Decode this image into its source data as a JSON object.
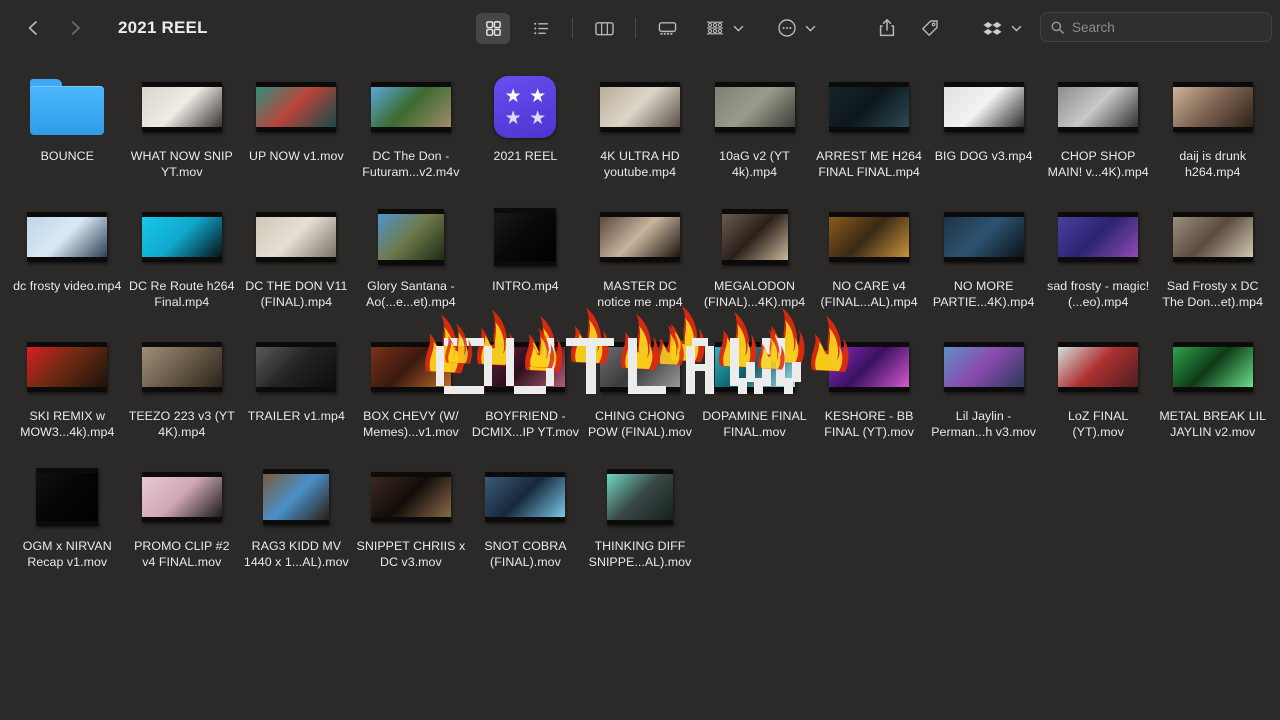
{
  "window": {
    "title": "2021 REEL",
    "background_color": "#2b2a28"
  },
  "toolbar": {
    "back_label": "Back",
    "forward_label": "Forward",
    "view_modes": [
      {
        "name": "icon-view",
        "label": "Icon View",
        "selected": true
      },
      {
        "name": "list-view",
        "label": "List View",
        "selected": false
      },
      {
        "name": "column-view",
        "label": "Column View",
        "selected": false
      },
      {
        "name": "gallery-view",
        "label": "Gallery View",
        "selected": false
      }
    ],
    "group_by_label": "Group",
    "more_label": "More",
    "share_label": "Share",
    "tag_label": "Tags",
    "dropbox_label": "Dropbox"
  },
  "search": {
    "placeholder": "Search",
    "value": ""
  },
  "watermark": {
    "text": "OUTLAW",
    "colors": {
      "fill": "#ececec",
      "flame_red": "#e02b0e",
      "flame_yellow": "#ffd21a"
    }
  },
  "files": [
    {
      "name": "BOUNCE",
      "kind": "folder",
      "accent": "#3fa9f5"
    },
    {
      "name": "WHAT NOW SNIP YT.mov",
      "kind": "video",
      "shape": "wide",
      "c1": "#d9d4cc",
      "c2": "#efece6",
      "c3": "#3a3330"
    },
    {
      "name": "UP NOW v1.mov",
      "kind": "video",
      "shape": "wide",
      "c1": "#2f8f7e",
      "c2": "#b9443a",
      "c3": "#164a49"
    },
    {
      "name": "DC The Don - Futuram...v2.m4v",
      "kind": "video",
      "shape": "wide",
      "c1": "#5aa7d8",
      "c2": "#3c6b2e",
      "c3": "#a08a6d"
    },
    {
      "name": "2021 REEL",
      "kind": "app",
      "accent": "#5b43e8"
    },
    {
      "name": "4K ULTRA HD youtube.mp4",
      "kind": "video",
      "shape": "wide",
      "c1": "#b8ad9c",
      "c2": "#ddd6c8",
      "c3": "#5a5047"
    },
    {
      "name": "10aG v2 (YT 4k).mp4",
      "kind": "video",
      "shape": "wide",
      "c1": "#7e7f72",
      "c2": "#9b9c8c",
      "c3": "#3c3d36"
    },
    {
      "name": "ARREST ME H264 FINAL FINAL.mp4",
      "kind": "video",
      "shape": "wide",
      "c1": "#16262c",
      "c2": "#0c171b",
      "c3": "#2c4a52"
    },
    {
      "name": "BIG DOG v3.mp4",
      "kind": "video",
      "shape": "wide",
      "c1": "#e2e2e2",
      "c2": "#f2f2f2",
      "c3": "#2b2b2b"
    },
    {
      "name": "CHOP SHOP MAIN! v...4K).mp4",
      "kind": "video",
      "shape": "wide",
      "c1": "#8d8d8d",
      "c2": "#c8c8c8",
      "c3": "#323232"
    },
    {
      "name": "daij is drunk h264.mp4",
      "kind": "video",
      "shape": "wide",
      "c1": "#cbb39b",
      "c2": "#7d6451",
      "c3": "#2e2119"
    },
    {
      "name": "dc frosty video.mp4",
      "kind": "video",
      "shape": "wide",
      "c1": "#bcd6ea",
      "c2": "#dbe9f4",
      "c3": "#2c3f58"
    },
    {
      "name": "DC Re Route h264 Final.mp4",
      "kind": "video",
      "shape": "wide",
      "c1": "#18c8e8",
      "c2": "#0fa8cc",
      "c3": "#071215"
    },
    {
      "name": "DC THE DON V11 (FINAL).mp4",
      "kind": "video",
      "shape": "wide",
      "c1": "#cfc7b8",
      "c2": "#e6e0d4",
      "c3": "#7a7164"
    },
    {
      "name": "Glory Santana - Ao(...e...et).mp4",
      "kind": "video",
      "shape": "tallish",
      "c1": "#4f95cf",
      "c2": "#6e7a4a",
      "c3": "#1d2a16"
    },
    {
      "name": "INTRO.mp4",
      "kind": "video",
      "shape": "square",
      "c1": "#1a1a1a",
      "c2": "#080808",
      "c3": "#000000"
    },
    {
      "name": "MASTER DC notice me .mp4",
      "kind": "video",
      "shape": "wide",
      "c1": "#5b4a40",
      "c2": "#c9b49d",
      "c3": "#1b1410"
    },
    {
      "name": "MEGALODON (FINAL)...4K).mp4",
      "kind": "video",
      "shape": "tallish",
      "c1": "#6d5a49",
      "c2": "#2a211b",
      "c3": "#cbb69b"
    },
    {
      "name": "NO CARE v4 (FINAL...AL).mp4",
      "kind": "video",
      "shape": "wide",
      "c1": "#8a5a1c",
      "c2": "#3a2a15",
      "c3": "#c8923c"
    },
    {
      "name": "NO MORE PARTIE...4K).mp4",
      "kind": "video",
      "shape": "wide",
      "c1": "#1d3448",
      "c2": "#2e5370",
      "c3": "#0a131b"
    },
    {
      "name": "sad frosty - magic! (...eo).mp4",
      "kind": "video",
      "shape": "wide",
      "c1": "#4a3fa0",
      "c2": "#2c2470",
      "c3": "#8f4bb5"
    },
    {
      "name": "Sad Frosty x DC The Don...et).mp4",
      "kind": "video",
      "shape": "wide",
      "c1": "#9c8e7f",
      "c2": "#5a4b3c",
      "c3": "#d2c7b6"
    },
    {
      "name": "SKI REMIX w MOW3...4k).mp4",
      "kind": "video",
      "shape": "wide",
      "c1": "#d81f1f",
      "c2": "#6a2b14",
      "c3": "#1d1108"
    },
    {
      "name": "TEEZO 223 v3 (YT 4K).mp4",
      "kind": "video",
      "shape": "wide",
      "c1": "#9f8f7a",
      "c2": "#6a5c49",
      "c3": "#2b241b"
    },
    {
      "name": "TRAILER v1.mp4",
      "kind": "video",
      "shape": "wide",
      "c1": "#5a5a5a",
      "c2": "#232323",
      "c3": "#0d0d0d"
    },
    {
      "name": "BOX CHEVY (W/ Memes)...v1.mov",
      "kind": "video",
      "shape": "wide",
      "c1": "#7a3018",
      "c2": "#3a1a10",
      "c3": "#c06a2a"
    },
    {
      "name": "BOYFRIEND - DCMIX...IP YT.mov",
      "kind": "video",
      "shape": "wide",
      "c1": "#6a2040",
      "c2": "#2a0f1c",
      "c3": "#b45a78"
    },
    {
      "name": "CHING CHONG POW (FINAL).mov",
      "kind": "video",
      "shape": "wide",
      "c1": "#6f6f6f",
      "c2": "#3a3a3a",
      "c3": "#9a9a9a"
    },
    {
      "name": "DOPAMINE FINAL FINAL.mov",
      "kind": "video",
      "shape": "wide",
      "c1": "#2ab5c4",
      "c2": "#0f5a66",
      "c3": "#9fe4ec"
    },
    {
      "name": "KESHORE - BB FINAL (YT).mov",
      "kind": "video",
      "shape": "wide",
      "c1": "#8a2ec0",
      "c2": "#3a1060",
      "c3": "#d45ad0"
    },
    {
      "name": "Lil Jaylin - Perman...h v3.mov",
      "kind": "video",
      "shape": "wide",
      "c1": "#5f8fc4",
      "c2": "#8a4ab0",
      "c3": "#2a3a58"
    },
    {
      "name": "LoZ FINAL (YT).mov",
      "kind": "video",
      "shape": "wide",
      "c1": "#cfe0dc",
      "c2": "#b03030",
      "c3": "#4a2020"
    },
    {
      "name": "METAL BREAK LIL JAYLIN v2.mov",
      "kind": "video",
      "shape": "wide",
      "c1": "#2fa34a",
      "c2": "#0f3a18",
      "c3": "#6ae08a"
    },
    {
      "name": "OGM x NIRVAN Recap v1.mov",
      "kind": "video",
      "shape": "square",
      "c1": "#121212",
      "c2": "#050505",
      "c3": "#000000"
    },
    {
      "name": "PROMO CLIP #2 v4 FINAL.mov",
      "kind": "video",
      "shape": "wide",
      "c1": "#e8c8d0",
      "c2": "#cfa8b4",
      "c3": "#1a1a1a"
    },
    {
      "name": "RAG3 KIDD MV 1440 x 1...AL).mov",
      "kind": "video",
      "shape": "tallish",
      "c1": "#7a5a3a",
      "c2": "#4a90c8",
      "c3": "#2a1e12"
    },
    {
      "name": "SNIPPET CHRIIS x DC v3.mov",
      "kind": "video",
      "shape": "wide",
      "c1": "#3a2a20",
      "c2": "#120c08",
      "c3": "#8a6a4a"
    },
    {
      "name": "SNOT COBRA (FINAL).mov",
      "kind": "video",
      "shape": "wide",
      "c1": "#3a5a78",
      "c2": "#16283a",
      "c3": "#7ac8e8"
    },
    {
      "name": "THINKING DIFF SNIPPE...AL).mov",
      "kind": "video",
      "shape": "tallish",
      "c1": "#6fd8c0",
      "c2": "#3a4a48",
      "c3": "#15201e"
    }
  ]
}
